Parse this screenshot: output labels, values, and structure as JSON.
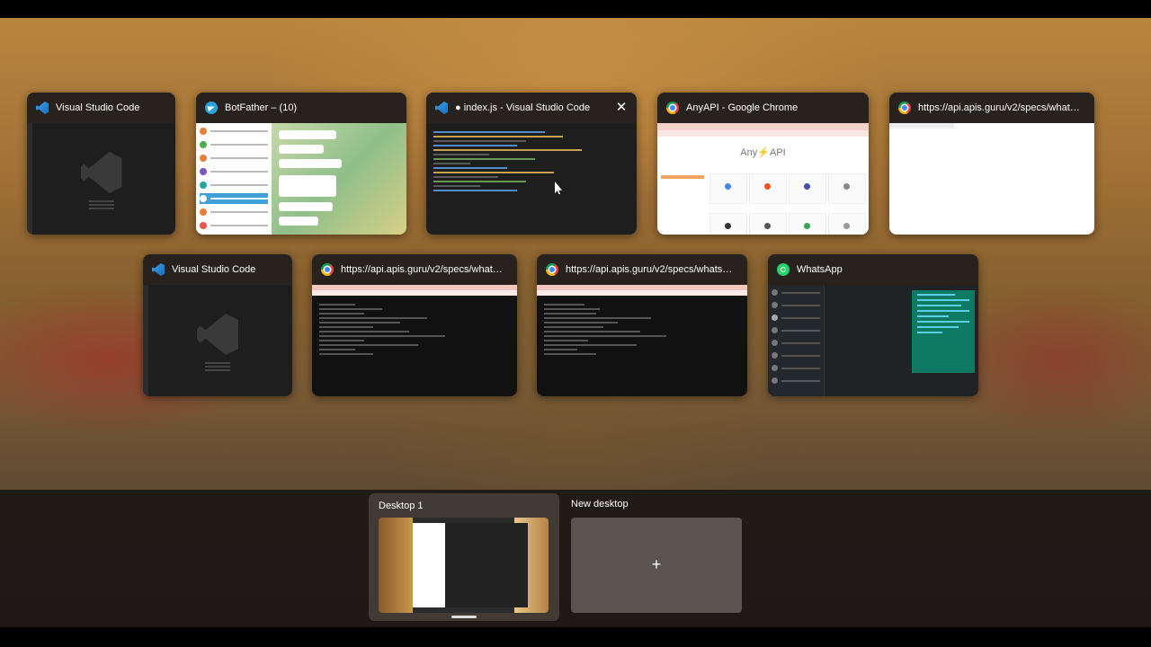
{
  "windows_row1": [
    {
      "title": "Visual Studio Code",
      "icon": "vscode-icon"
    },
    {
      "title": "BotFather – (10)",
      "icon": "telegram-icon"
    },
    {
      "title": "● index.js - Visual Studio Code",
      "icon": "vscode-icon",
      "close": "✕"
    },
    {
      "title": "AnyAPI - Google Chrome",
      "icon": "chrome-icon"
    },
    {
      "title": "https://api.apis.guru/v2/specs/whatsa...",
      "icon": "chrome-icon"
    }
  ],
  "windows_row2": [
    {
      "title": "Visual Studio Code",
      "icon": "vscode-icon"
    },
    {
      "title": "https://api.apis.guru/v2/specs/whatsa...",
      "icon": "chrome-icon"
    },
    {
      "title": "https://api.apis.guru/v2/specs/whatsap...",
      "icon": "chrome-icon"
    },
    {
      "title": "WhatsApp",
      "icon": "whatsapp-icon"
    }
  ],
  "anyapi": {
    "logo_left": "Any",
    "logo_bolt": "⚡",
    "logo_right": "API"
  },
  "desktops": {
    "current": "Desktop 1",
    "new_label": "New desktop",
    "new_plus": "+"
  },
  "colors": {
    "accent": "#419fd9",
    "bolt": "#f4511e"
  }
}
